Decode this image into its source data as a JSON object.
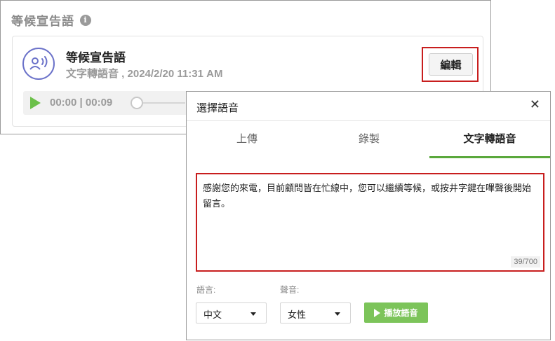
{
  "card": {
    "section_title": "等候宣告語",
    "item_title": "等候宣告語",
    "item_subtitle": "文字轉語音 , 2024/2/20 11:31 AM",
    "edit_label": "編輯",
    "player_time": "00:00 | 00:09"
  },
  "modal": {
    "title": "選擇語音",
    "close_label": "✕",
    "tabs": [
      {
        "label": "上傳",
        "active": false
      },
      {
        "label": "錄製",
        "active": false
      },
      {
        "label": "文字轉語音",
        "active": true
      }
    ],
    "text_value": "感謝您的來電，目前顧問皆在忙線中，您可以繼續等候，或按井字鍵在嗶聲後開始留言。",
    "char_count": "39/700",
    "language_label": "語言:",
    "language_value": "中文",
    "voice_label": "聲音:",
    "voice_value": "女性",
    "play_label": "播放語音"
  },
  "colors": {
    "accent_green": "#7cc45a",
    "highlight_red": "#c81e1e",
    "avatar_purple": "#6b72c9"
  }
}
